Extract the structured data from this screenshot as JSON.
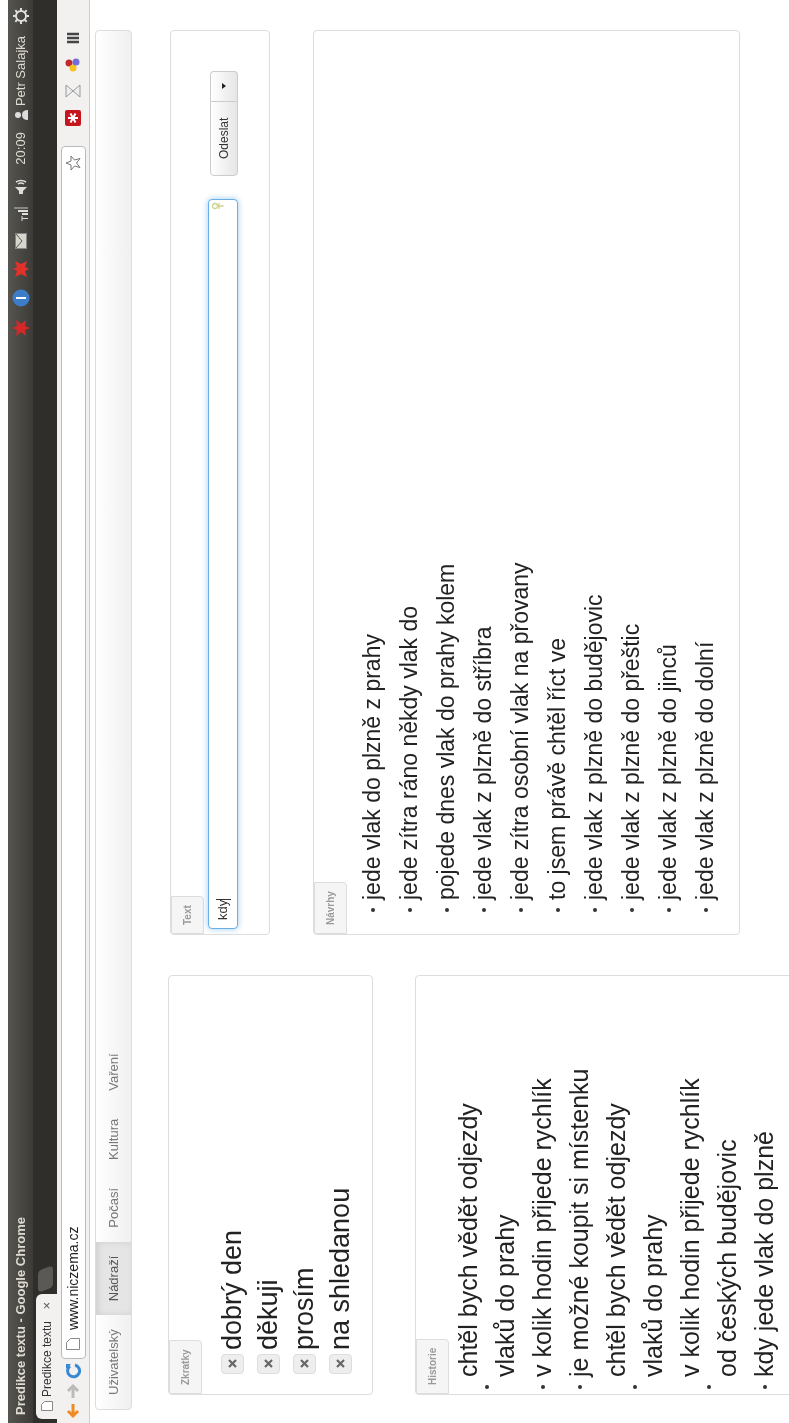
{
  "window": {
    "title": "Predikce textu - Google Chrome"
  },
  "top_panel": {
    "time": "20:09",
    "user": "Petr Salajka"
  },
  "browser_tab": {
    "title": "Predikce textu",
    "close": "×"
  },
  "address_bar": {
    "url": "www.niczema.cz"
  },
  "nav_tabs": [
    {
      "label": "Uživatelský",
      "selected": false
    },
    {
      "label": "Nádraží",
      "selected": true
    },
    {
      "label": "Počasí",
      "selected": false
    },
    {
      "label": "Kultura",
      "selected": false
    },
    {
      "label": "Vaření",
      "selected": false
    }
  ],
  "shortcuts": {
    "title": "Zkratky",
    "items": [
      "dobrý den",
      "děkuji",
      "prosím",
      "na shledanou"
    ]
  },
  "history": {
    "title": "Historie",
    "items": [
      "chtěl bych vědět odjezdy vlaků do prahy",
      "v kolik hodin přijede rychlík",
      "je možné koupit si místenku",
      "chtěl bych vědět odjezdy vlaků do prahy",
      "v kolik hodin přijede rychlík od českých budějovic",
      "kdy jede vlak do plzně"
    ]
  },
  "text_panel": {
    "title": "Text",
    "input": {
      "value": "kdy"
    },
    "send_button": "Odeslat"
  },
  "suggestions": {
    "title": "Návrhy",
    "items": [
      "jede vlak do plzně z prahy",
      "jede zítra ráno někdy vlak do",
      "pojede dnes vlak do prahy kolem",
      "jede vlak z plzně do stříbra",
      "jede zítra osobní vlak na přovany",
      "to jsem právě chtěl říct ve",
      "jede vlak z plzně do budějovic",
      "jede vlak z plzně do přeštic",
      "jede vlak z plzně do jinců",
      "jede vlak z plzně do dolní"
    ]
  }
}
